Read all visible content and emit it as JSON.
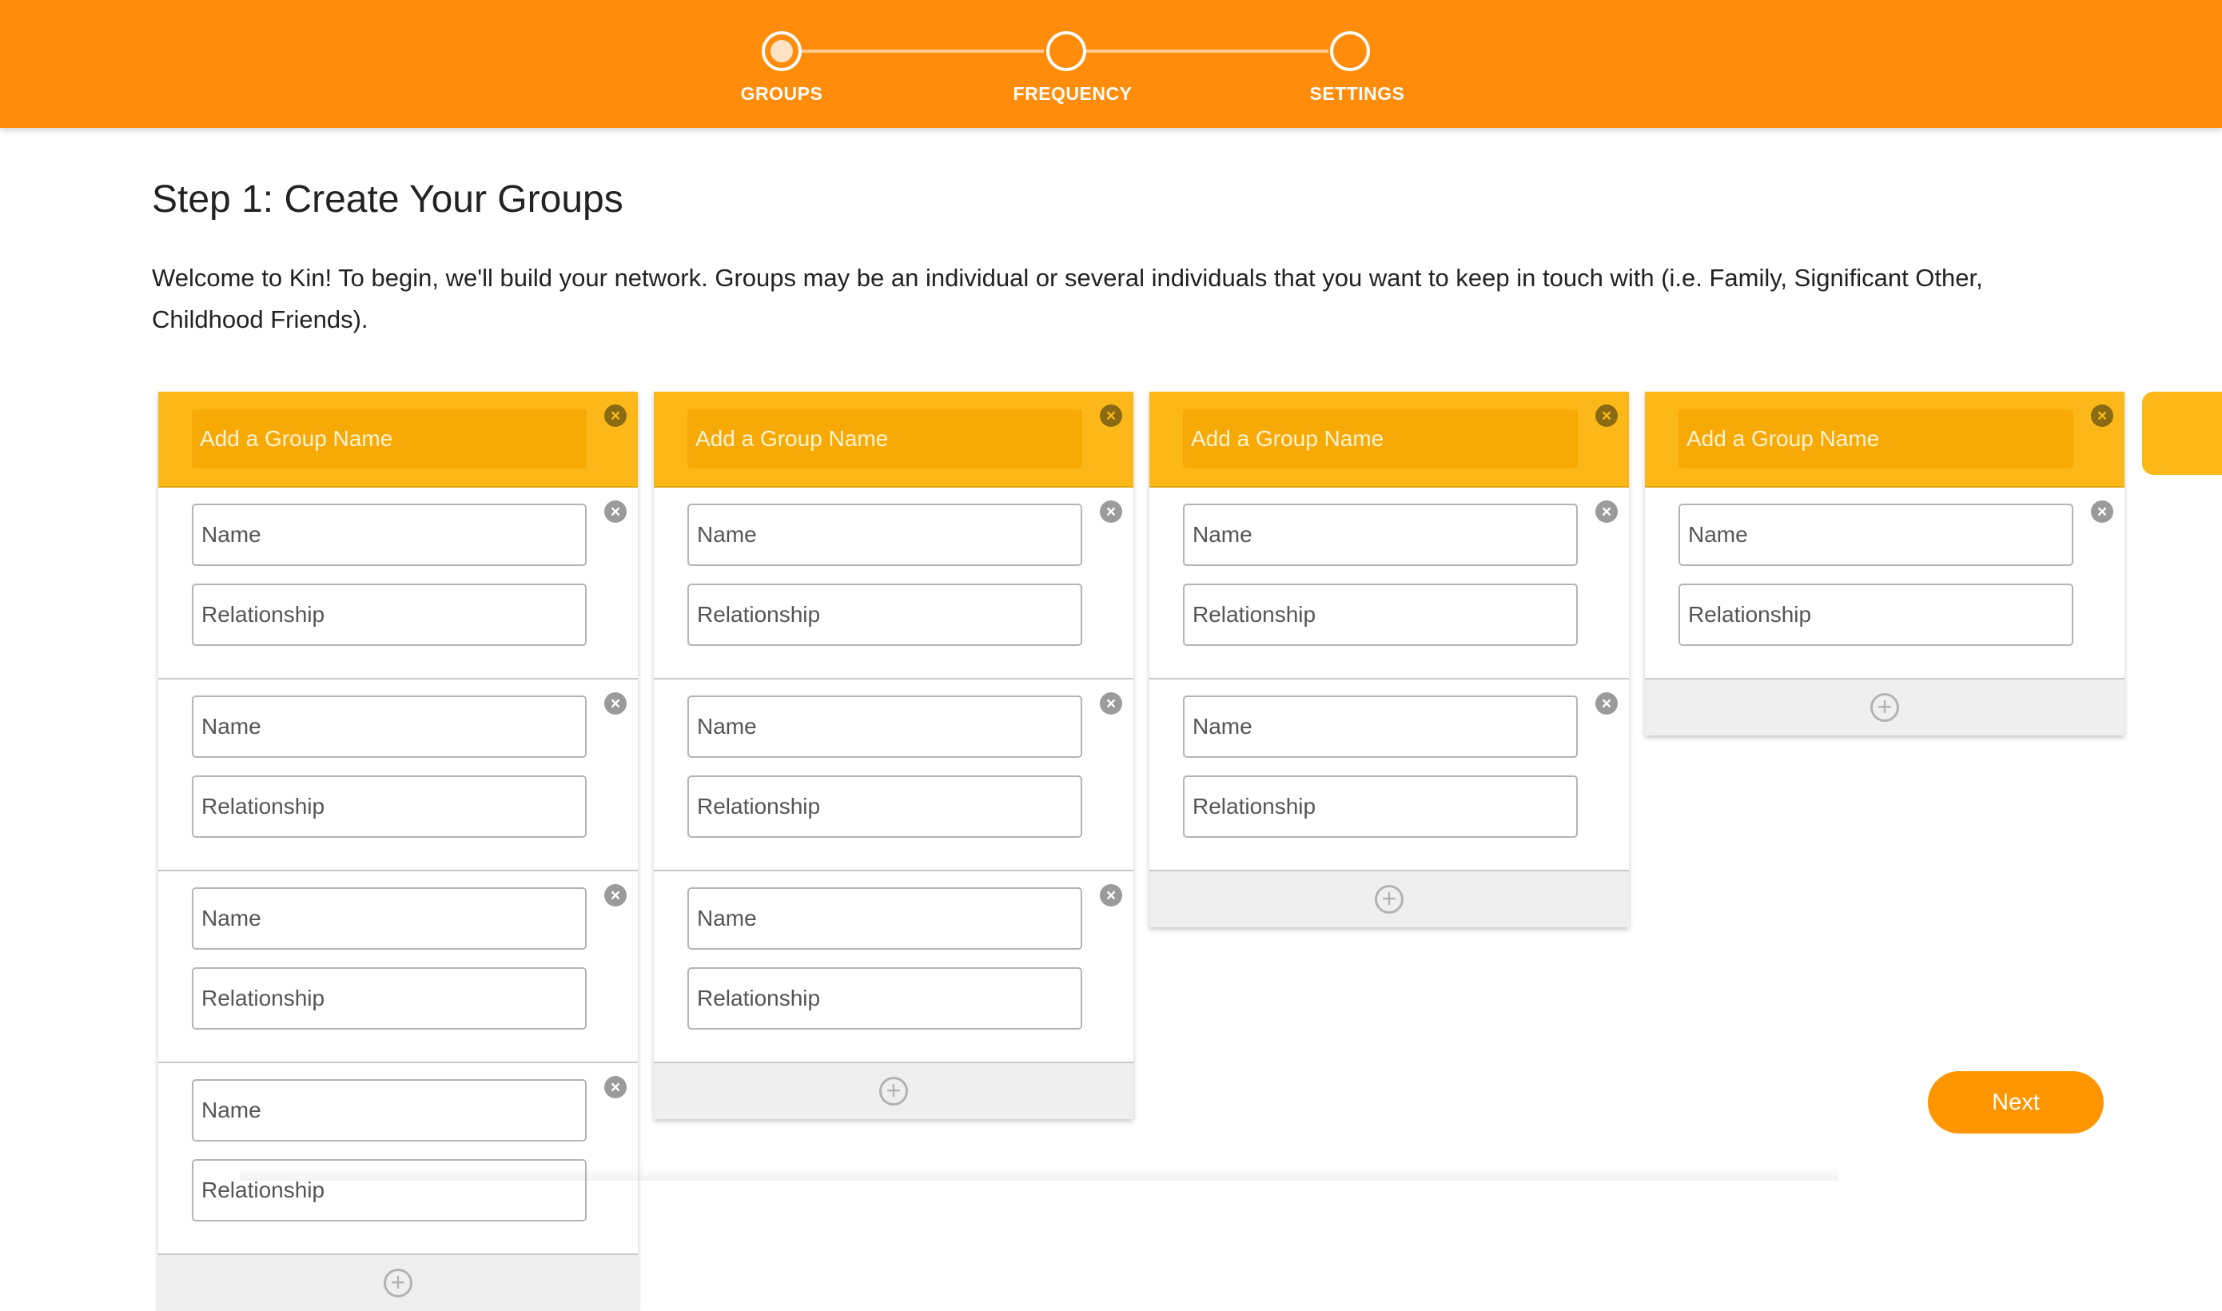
{
  "stepper": {
    "steps": [
      {
        "label": "GROUPS",
        "active": true
      },
      {
        "label": "FREQUENCY",
        "active": false
      },
      {
        "label": "SETTINGS",
        "active": false
      }
    ]
  },
  "page": {
    "title": "Step 1: Create Your Groups",
    "intro": "Welcome to Kin! To begin, we'll build your network. Groups may be an individual or several individuals that you want to keep in touch with (i.e. Family, Significant Other, Childhood Friends)."
  },
  "groups": [
    {
      "name_placeholder": "Add a Group Name",
      "member_count": 4
    },
    {
      "name_placeholder": "Add a Group Name",
      "member_count": 3
    },
    {
      "name_placeholder": "Add a Group Name",
      "member_count": 2
    },
    {
      "name_placeholder": "Add a Group Name",
      "member_count": 1
    }
  ],
  "member_fields": {
    "name_placeholder": "Name",
    "relationship_placeholder": "Relationship"
  },
  "icons": {
    "remove": "close-circle-icon",
    "add": "plus-circle-icon"
  },
  "actions": {
    "next_label": "Next"
  },
  "colors": {
    "top_bar": "#ff8c0a",
    "group_header": "#fbb818",
    "next_button": "#ff9500"
  }
}
